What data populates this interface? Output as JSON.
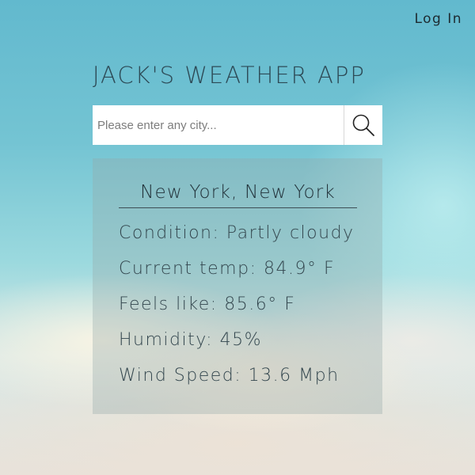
{
  "header": {
    "login_label": "Log In"
  },
  "app": {
    "title": "JACK'S WEATHER APP"
  },
  "search": {
    "placeholder": "Please enter any city...",
    "value": "",
    "button_icon": "search-icon"
  },
  "weather": {
    "location": "New York, New York",
    "rows": [
      {
        "label": "Condition:",
        "value": "Partly cloudy"
      },
      {
        "label": "Current temp:",
        "value": "84.9° F"
      },
      {
        "label": "Feels like:",
        "value": "85.6° F"
      },
      {
        "label": "Humidity:",
        "value": "45%"
      },
      {
        "label": "Wind Speed:",
        "value": "13.6 Mph"
      }
    ]
  },
  "colors": {
    "sky_top": "#62b9ce",
    "title_text": "#2d4a56",
    "card_bg": "rgba(150,170,170,0.35)"
  }
}
